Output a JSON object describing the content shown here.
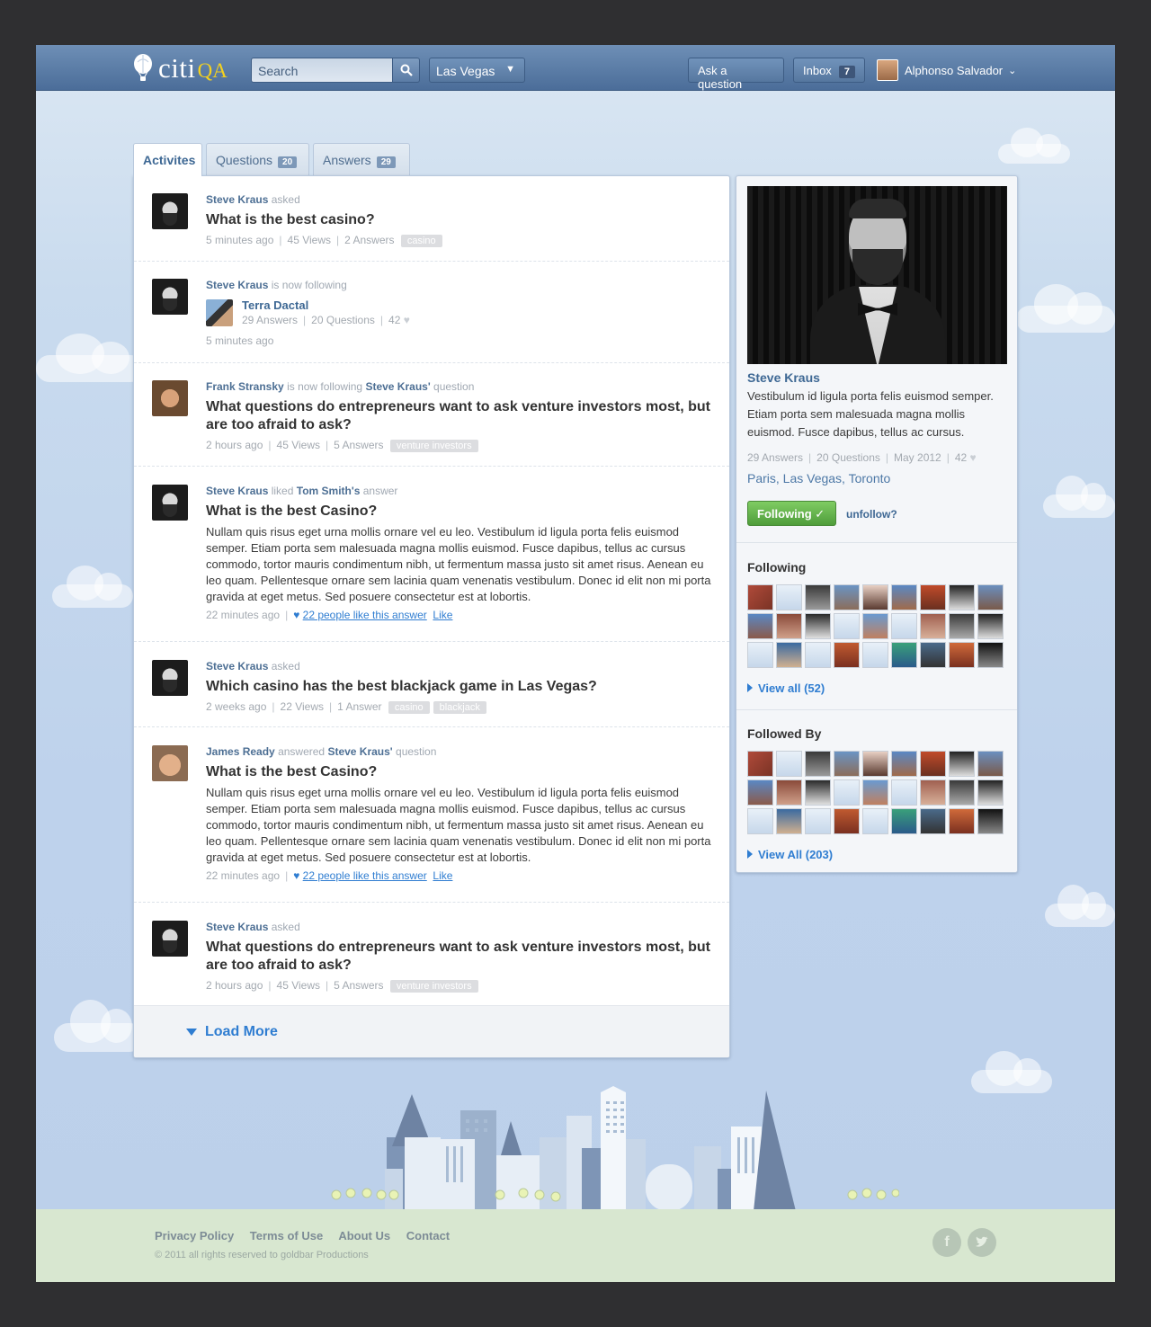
{
  "header": {
    "logo_citi": "citi",
    "logo_qa": "QA",
    "search_placeholder": "Search",
    "location": "Las Vegas",
    "ask_label": "Ask a question",
    "inbox_label": "Inbox",
    "inbox_count": "7",
    "user_name": "Alphonso Salvador"
  },
  "tabs": [
    {
      "label": "Activites",
      "count": ""
    },
    {
      "label": "Questions",
      "count": "20"
    },
    {
      "label": "Answers",
      "count": "29"
    }
  ],
  "feed": {
    "items": [
      {
        "actor": "Steve Kraus",
        "action": "asked",
        "question": "What is the best casino?",
        "time": "5 minutes ago",
        "views": "45 Views",
        "answers": "2 Answers",
        "tags": [
          "casino"
        ]
      },
      {
        "actor": "Steve Kraus",
        "action": "is now following",
        "person_name": "Terra Dactal",
        "person_answers": "29 Answers",
        "person_questions": "20 Questions",
        "person_likes": "42",
        "time": "5 minutes ago"
      },
      {
        "actor": "Frank Stransky",
        "action": "is now following",
        "target": "Steve Kraus'",
        "target_suffix": "question",
        "question": "What questions do entrepreneurs want to ask venture investors most, but are too afraid to ask?",
        "time": "2 hours ago",
        "views": "45 Views",
        "answers": "5 Answers",
        "tags": [
          "venture investors"
        ]
      },
      {
        "actor": "Steve Kraus",
        "action": "liked",
        "target": "Tom Smith's",
        "target_suffix": "answer",
        "question": "What is the best Casino?",
        "body": "Nullam quis risus eget urna mollis ornare vel eu leo. Vestibulum id ligula porta felis euismod semper. Etiam porta sem malesuada magna mollis euismod. Fusce dapibus, tellus ac cursus commodo, tortor mauris condimentum nibh, ut fermentum massa justo sit amet risus. Aenean eu leo quam. Pellentesque ornare sem lacinia quam venenatis vestibulum. Donec id elit non mi porta gravida at eget metus. Sed posuere consectetur est at lobortis.",
        "time": "22 minutes ago",
        "likes_text": "22 people like this answer",
        "like_label": "Like"
      },
      {
        "actor": "Steve Kraus",
        "action": "asked",
        "question": "Which casino has the best blackjack game in Las Vegas?",
        "time": "2 weeks ago",
        "views": "22 Views",
        "answers": "1 Answer",
        "tags": [
          "casino",
          "blackjack"
        ]
      },
      {
        "actor": "James Ready",
        "action": "answered",
        "target": "Steve Kraus'",
        "target_suffix": "question",
        "question": "What is the best Casino?",
        "body": "Nullam quis risus eget urna mollis ornare vel eu leo. Vestibulum id ligula porta felis euismod semper. Etiam porta sem malesuada magna mollis euismod. Fusce dapibus, tellus ac cursus commodo, tortor mauris condimentum nibh, ut fermentum massa justo sit amet risus. Aenean eu leo quam. Pellentesque ornare sem lacinia quam venenatis vestibulum. Donec id elit non mi porta gravida at eget metus. Sed posuere consectetur est at lobortis.",
        "time": "22 minutes ago",
        "likes_text": "22 people like this answer",
        "like_label": "Like"
      },
      {
        "actor": "Steve Kraus",
        "action": "asked",
        "question": "What questions do entrepreneurs want to ask venture investors most, but are too afraid to ask?",
        "time": "2 hours ago",
        "views": "45 Views",
        "answers": "5 Answers",
        "tags": [
          "venture investors"
        ]
      }
    ],
    "load_more": "Load More"
  },
  "profile": {
    "name": "Steve Kraus",
    "bio": "Vestibulum id ligula porta felis euismod semper. Etiam porta sem malesuada magna mollis euismod. Fusce dapibus, tellus ac cursus.",
    "answers": "29 Answers",
    "questions": "20 Questions",
    "joined": "May 2012",
    "likes": "42",
    "locations": "Paris, Las Vegas, Toronto",
    "following_btn": "Following ✓",
    "unfollow": "unfollow?",
    "following_title": "Following",
    "following_view_all": "View all (52)",
    "followed_title": "Followed By",
    "followed_view_all": "View All (203)"
  },
  "footer": {
    "links": [
      "Privacy Policy",
      "Terms of Use",
      "About Us",
      "Contact"
    ],
    "copyright": "© 2011 all rights reserved to goldbar Productions"
  },
  "colors": {
    "accent": "#2f7dd1",
    "header": "#4b6d99",
    "following_green": "#5fad46",
    "sky": "#bcd0ea",
    "ground": "#d8e7d0"
  }
}
